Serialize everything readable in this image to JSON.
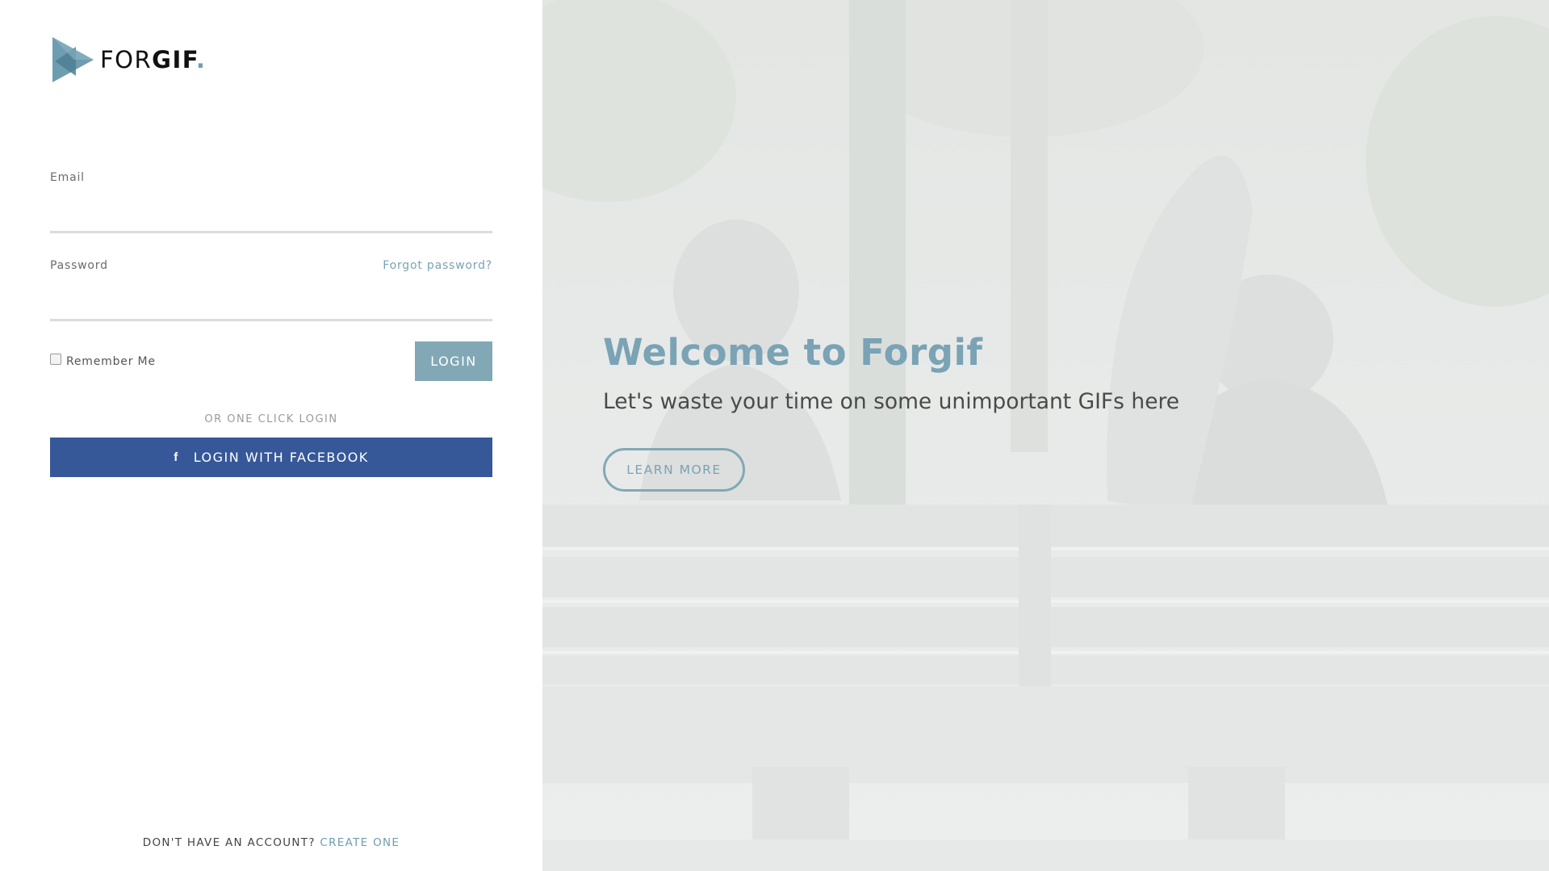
{
  "brand": {
    "name_light": "FOR",
    "name_bold": "GIF",
    "dot": ".",
    "colors": {
      "accent": "#7aa3b5",
      "button": "#82a8b5",
      "facebook": "#365899"
    }
  },
  "login_form": {
    "email_label": "Email",
    "email_value": "",
    "password_label": "Password",
    "password_value": "",
    "forgot_password": "Forgot password?",
    "remember_me": "Remember Me",
    "remember_checked": false,
    "login_button": "LOGIN",
    "or_text": "OR ONE CLICK LOGIN",
    "facebook_icon": "f",
    "facebook_button": "LOGIN WITH FACEBOOK"
  },
  "signup": {
    "prompt": "DON'T HAVE AN ACCOUNT?",
    "link": "CREATE ONE"
  },
  "hero": {
    "title": "Welcome to Forgif",
    "subtitle": "Let's waste your time on some unimportant GIFs here",
    "cta": "LEARN MORE"
  }
}
